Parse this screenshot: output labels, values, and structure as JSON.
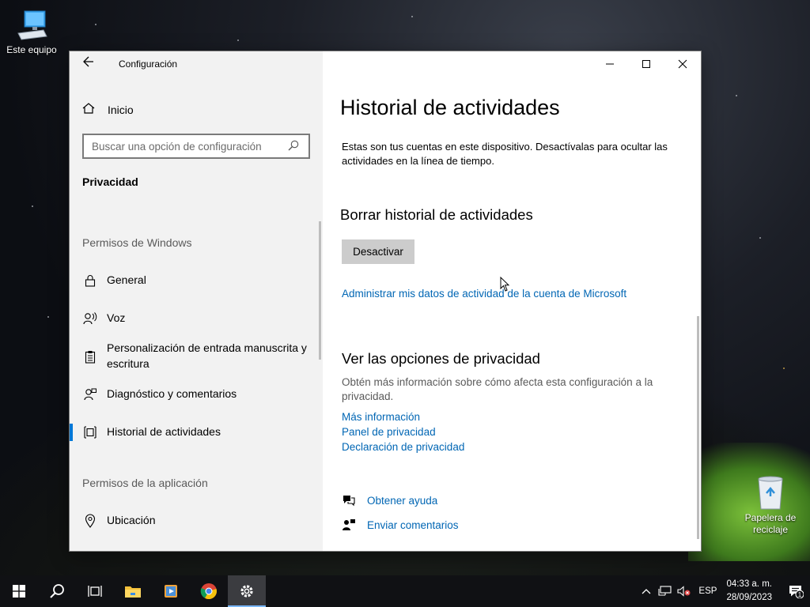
{
  "desktop": {
    "icons": [
      {
        "label": "Este equipo"
      },
      {
        "label": "Papelera de reciclaje"
      }
    ]
  },
  "window": {
    "title": "Configuración",
    "sidebar": {
      "home": "Inicio",
      "search_placeholder": "Buscar una opción de configuración",
      "section": "Privacidad",
      "group_windows": "Permisos de Windows",
      "group_app": "Permisos de la aplicación",
      "items": [
        {
          "label": "General",
          "icon": "lock-icon"
        },
        {
          "label": "Voz",
          "icon": "voice-icon"
        },
        {
          "label": "Personalización de entrada manuscrita y escritura",
          "icon": "clipboard-icon"
        },
        {
          "label": "Diagnóstico y comentarios",
          "icon": "feedback-icon"
        },
        {
          "label": "Historial de actividades",
          "icon": "timeline-icon",
          "selected": true
        },
        {
          "label": "Ubicación",
          "icon": "location-icon"
        }
      ]
    },
    "content": {
      "title": "Historial de actividades",
      "description": "Estas son tus cuentas en este dispositivo. Desactívalas para ocultar las actividades en la línea de tiempo.",
      "clear_heading": "Borrar historial de actividades",
      "deactivate_button": "Desactivar",
      "manage_link": "Administrar mis datos de actividad de la cuenta de Microsoft",
      "privacy_heading": "Ver las opciones de privacidad",
      "privacy_desc": "Obtén más información sobre cómo afecta esta configuración a la privacidad.",
      "links": [
        "Más información",
        "Panel de privacidad",
        "Declaración de privacidad"
      ],
      "help": "Obtener ayuda",
      "feedback": "Enviar comentarios"
    }
  },
  "taskbar": {
    "language": "ESP",
    "time": "04:33 a. m.",
    "date": "28/09/2023",
    "notifications": "1"
  },
  "colors": {
    "accent": "#0078d7",
    "link": "#0066b4"
  }
}
